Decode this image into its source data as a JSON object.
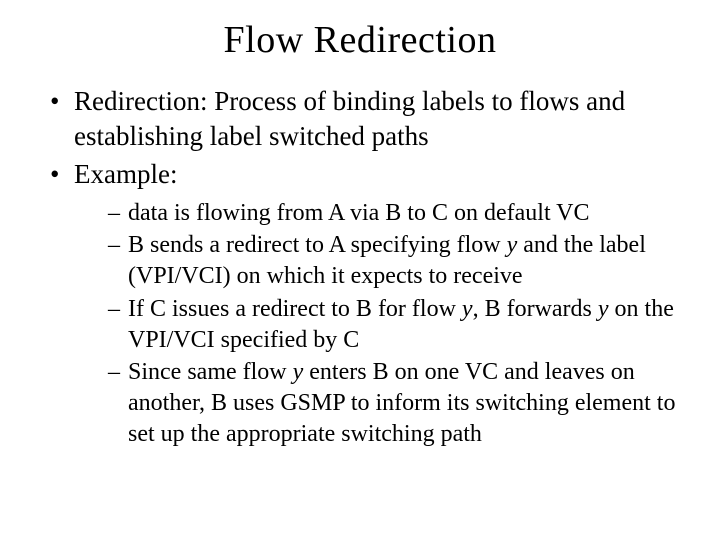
{
  "title": "Flow Redirection",
  "bullets": [
    "Redirection: Process of binding labels to flows and establishing label switched paths",
    "Example:"
  ],
  "sub": {
    "s1": "data is flowing from A via B to C on default VC",
    "s2a": "B sends a redirect to A specifying flow ",
    "s2b": " and the label (VPI/VCI) on which it expects to receive",
    "s3a": "If C issues a redirect to B for flow ",
    "s3b": ", B forwards ",
    "s3c": " on the VPI/VCI specified by C",
    "s4a": "Since same flow ",
    "s4b": " enters B on one VC and leaves on another, B uses GSMP to inform its switching element to set up the appropriate switching path",
    "y": "y"
  }
}
